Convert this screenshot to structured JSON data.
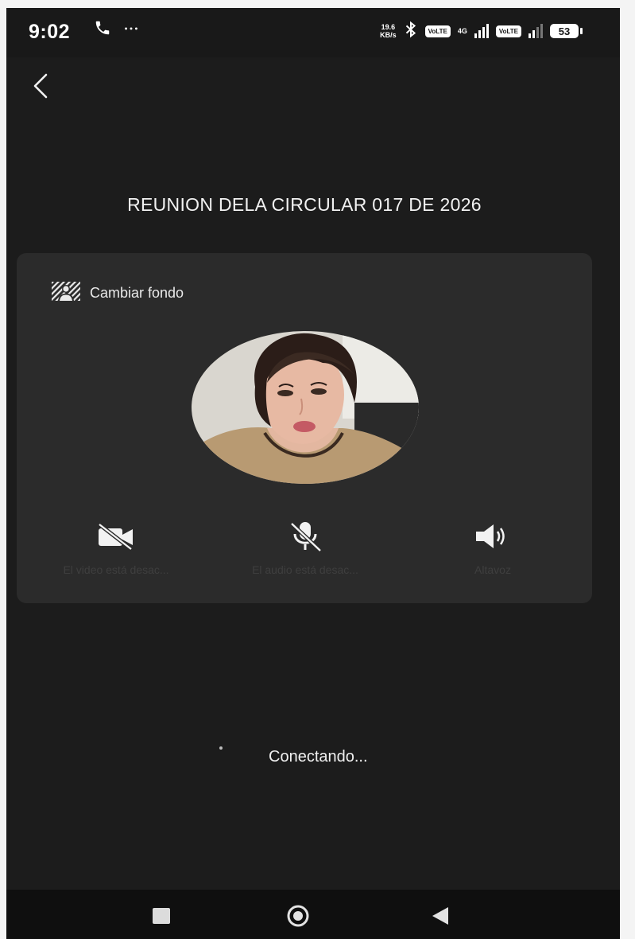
{
  "status_bar": {
    "time": "9:02",
    "left_icons": [
      "phone-call-icon",
      "more-dots-icon"
    ],
    "netspeed_value": "19.6",
    "netspeed_unit": "KB/s",
    "volte_1": "VoLTE",
    "network_type": "4G",
    "volte_2": "VoLTE",
    "battery": "53"
  },
  "meeting": {
    "title": "REUNION DELA CIRCULAR 017 DE 2026"
  },
  "card": {
    "change_background_label": "Cambiar fondo",
    "controls": [
      {
        "icon": "video-off-icon",
        "label": "El video está desac..."
      },
      {
        "icon": "mic-off-icon",
        "label": "El audio está desac..."
      },
      {
        "icon": "speaker-icon",
        "label": "Altavoz"
      }
    ]
  },
  "status": {
    "connecting_text": "Conectando..."
  },
  "navigation": {
    "items": [
      "recents-square-icon",
      "home-circle-icon",
      "back-triangle-icon"
    ]
  },
  "colors": {
    "screen_bg": "#1c1c1c",
    "card_bg": "#2b2b2b",
    "text": "#f2f2f2"
  }
}
